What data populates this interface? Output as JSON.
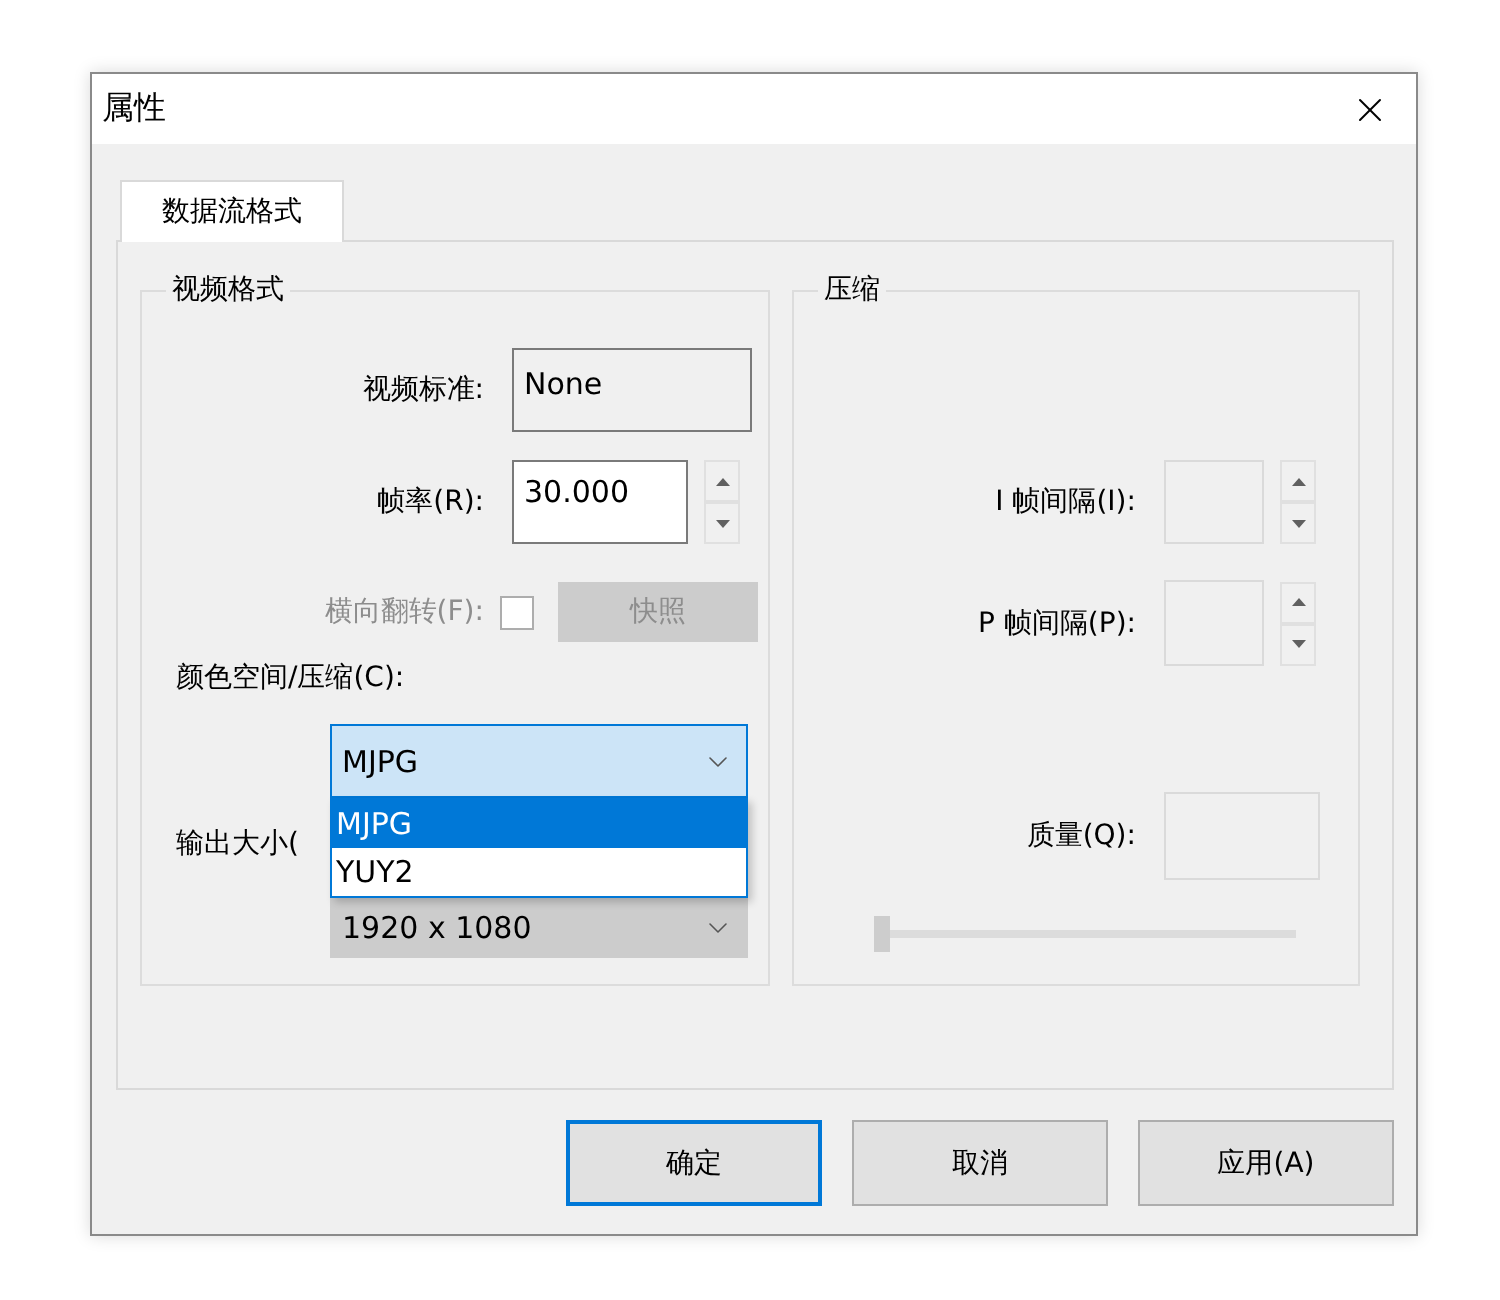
{
  "window": {
    "title": "属性"
  },
  "tabs": [
    {
      "label": "数据流格式",
      "selected": true
    }
  ],
  "video_format": {
    "title": "视频格式",
    "standard": {
      "label": "视频标准:",
      "value": "None"
    },
    "frame_rate": {
      "label": "帧率(R):",
      "value": "30.000"
    },
    "flip": {
      "label": "横向翻转(F):",
      "checked": false,
      "disabled": true
    },
    "snapshot_button": {
      "label": "快照",
      "disabled": true
    },
    "color_space": {
      "label": "颜色空间/压缩(C):",
      "value": "MJPG",
      "expanded": true,
      "options": [
        {
          "label": "MJPG",
          "selected": true
        },
        {
          "label": "YUY2",
          "selected": false
        }
      ]
    },
    "output_size": {
      "label": "输出大小(",
      "value": "1920 x 1080",
      "disabled": true
    }
  },
  "compression": {
    "title": "压缩",
    "i_frame": {
      "label": "I 帧间隔(I):"
    },
    "p_frame": {
      "label": "P 帧间隔(P):"
    },
    "quality": {
      "label": "质量(Q):",
      "level": 0
    }
  },
  "buttons": [
    {
      "label": "确定",
      "default": true
    },
    {
      "label": "取消",
      "default": false
    },
    {
      "label": "应用(A)",
      "default": false
    }
  ]
}
